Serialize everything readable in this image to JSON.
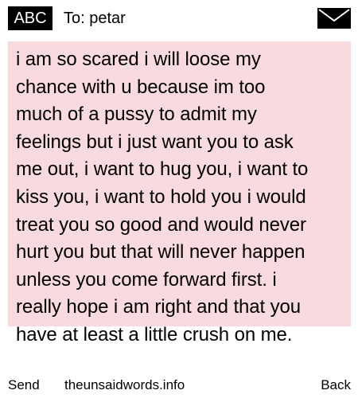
{
  "header": {
    "mode_label": "ABC",
    "recipient": "To: petar",
    "envelope_icon": "envelope-icon"
  },
  "message": {
    "text": "i am so scared i will loose my\nchance with u because im too\nmuch of a pussy to admit my\nfeelings but i just want you to ask\nme out, i want to hug you, i want to\nkiss you, i want to hold you i would\ntreat you so good and would never\nhurt you but that will never happen\nunless you come forward first. i\nreally hope i am right and that you\nhave at least a little crush on me.",
    "highlight_color": "#f9dadf"
  },
  "footer": {
    "send_label": "Send",
    "site_label": "theunsaidwords.info",
    "back_label": "Back"
  }
}
